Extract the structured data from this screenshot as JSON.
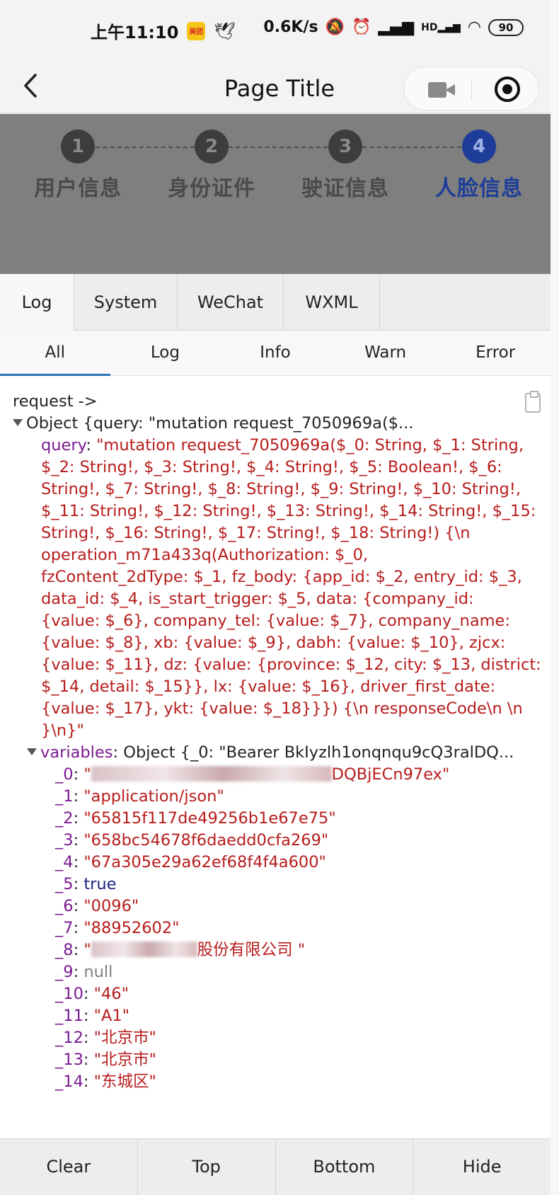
{
  "status_bar": {
    "time": "上午11:10",
    "app_badge": "美团",
    "net_speed": "0.6K/s",
    "network": "HD",
    "battery": "90"
  },
  "nav": {
    "title": "Page Title"
  },
  "steps": [
    {
      "num": "1",
      "label": "用户信息",
      "active": false
    },
    {
      "num": "2",
      "label": "身份证件",
      "active": false
    },
    {
      "num": "3",
      "label": "驶证信息",
      "active": false
    },
    {
      "num": "4",
      "label": "人脸信息",
      "active": true
    }
  ],
  "console": {
    "tabs": [
      "Log",
      "System",
      "WeChat",
      "WXML"
    ],
    "active_tab": "Log",
    "subtabs": [
      "All",
      "Log",
      "Info",
      "Warn",
      "Error"
    ],
    "active_subtab": "All",
    "log": {
      "header": "request ->",
      "object_summary": "Object {query: \"mutation request_7050969a($...",
      "query_key": "query",
      "query_lines": [
        "\"mutation request_7050969a($_0: String, $_1: String,",
        "$_2: String!, $_3: String!, $_4: String!, $_5: Boolean!, $_6:",
        "String!, $_7: String!, $_8: String!, $_9: String!, $_10: String!,",
        "$_11: String!, $_12: String!, $_13: String!, $_14: String!, $_15:",
        "String!, $_16: String!, $_17: String!, $_18: String!) {\\n",
        "operation_m71a433q(Authorization: $_0,",
        "fzContent_2dType: $_1, fz_body: {app_id: $_2, entry_id: $_3,",
        "data_id: $_4, is_start_trigger: $_5, data: {company_id:",
        "{value: $_6}, company_tel: {value: $_7}, company_name:",
        "{value: $_8}, xb: {value: $_9}, dabh: {value: $_10}, zjcx:",
        "{value: $_11}, dz: {value: {province: $_12, city: $_13, district:",
        "$_14, detail: $_15}}, lx: {value: $_16}, driver_first_date:",
        "{value: $_17}, ykt: {value: $_18}}}) {\\n responseCode\\n \\n",
        "}\\n}\""
      ],
      "variables_key": "variables",
      "variables_summary": "Object {_0: \"Bearer BkIyzlh1onqnqu9cQ3ralDQ...",
      "variables": [
        {
          "key": "_0",
          "value": "DQBjECn97ex\"",
          "kind": "str",
          "redacted": true
        },
        {
          "key": "_1",
          "value": "\"application/json\"",
          "kind": "str"
        },
        {
          "key": "_2",
          "value": "\"65815f117de49256b1e67e75\"",
          "kind": "str"
        },
        {
          "key": "_3",
          "value": "\"658bc54678f6daedd0cfa269\"",
          "kind": "str"
        },
        {
          "key": "_4",
          "value": "\"67a305e29a62ef68f4f4a600\"",
          "kind": "str"
        },
        {
          "key": "_5",
          "value": "true",
          "kind": "bool"
        },
        {
          "key": "_6",
          "value": "\"0096\"",
          "kind": "str"
        },
        {
          "key": "_7",
          "value": "\"88952602\"",
          "kind": "str"
        },
        {
          "key": "_8",
          "value": "股份有限公司 \"",
          "kind": "str",
          "redacted": true
        },
        {
          "key": "_9",
          "value": "null",
          "kind": "null"
        },
        {
          "key": "_10",
          "value": "\"46\"",
          "kind": "str"
        },
        {
          "key": "_11",
          "value": "\"A1\"",
          "kind": "str"
        },
        {
          "key": "_12",
          "value": "\"北京市\"",
          "kind": "str"
        },
        {
          "key": "_13",
          "value": "\"北京市\"",
          "kind": "str"
        },
        {
          "key": "_14",
          "value": "\"东城区\"",
          "kind": "str"
        }
      ]
    },
    "bottom_buttons": [
      "Clear",
      "Top",
      "Bottom",
      "Hide"
    ]
  }
}
